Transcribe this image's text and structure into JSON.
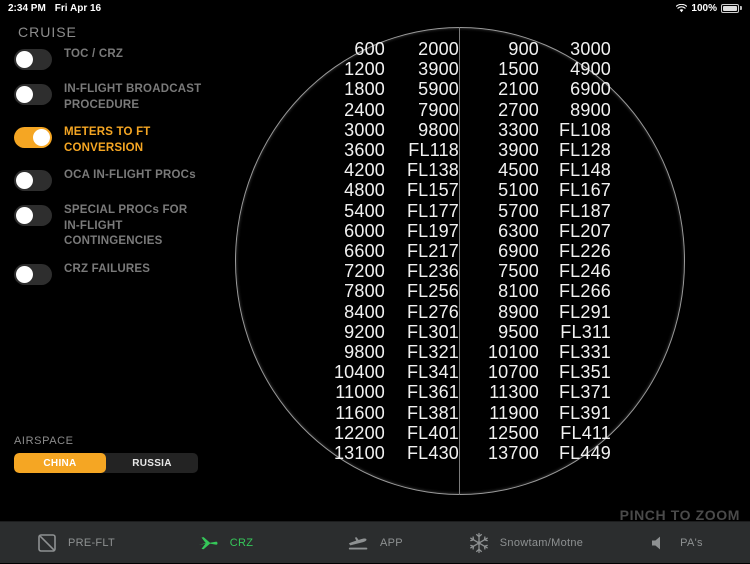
{
  "statusbar": {
    "time": "2:34 PM",
    "date": "Fri Apr 16",
    "wifi_icon": "wifi-icon",
    "battery_percent": "100%",
    "battery_icon": "battery-full-icon"
  },
  "sidebar": {
    "title": "CRUISE",
    "toggles": [
      {
        "label": "TOC / CRZ",
        "on": false
      },
      {
        "label": "IN-FLIGHT BROADCAST PROCEDURE",
        "on": false
      },
      {
        "label": "METERS TO FT CONVERSION",
        "on": true
      },
      {
        "label": "OCA IN-FLIGHT PROCs",
        "on": false
      },
      {
        "label": "SPECIAL PROCs FOR IN-FLIGHT CONTINGENCIES",
        "on": false
      },
      {
        "label": "CRZ FAILURES",
        "on": false
      }
    ],
    "airspace": {
      "label": "AIRSPACE",
      "options": [
        {
          "label": "CHINA",
          "selected": true
        },
        {
          "label": "RUSSIA",
          "selected": false
        }
      ]
    }
  },
  "main": {
    "pinch_hint": "PINCH TO ZOOM",
    "conversion_rows": [
      [
        "600",
        "2000",
        "900",
        "3000"
      ],
      [
        "1200",
        "3900",
        "1500",
        "4900"
      ],
      [
        "1800",
        "5900",
        "2100",
        "6900"
      ],
      [
        "2400",
        "7900",
        "2700",
        "8900"
      ],
      [
        "3000",
        "9800",
        "3300",
        "FL108"
      ],
      [
        "3600",
        "FL118",
        "3900",
        "FL128"
      ],
      [
        "4200",
        "FL138",
        "4500",
        "FL148"
      ],
      [
        "4800",
        "FL157",
        "5100",
        "FL167"
      ],
      [
        "5400",
        "FL177",
        "5700",
        "FL187"
      ],
      [
        "6000",
        "FL197",
        "6300",
        "FL207"
      ],
      [
        "6600",
        "FL217",
        "6900",
        "FL226"
      ],
      [
        "7200",
        "FL236",
        "7500",
        "FL246"
      ],
      [
        "7800",
        "FL256",
        "8100",
        "FL266"
      ],
      [
        "8400",
        "FL276",
        "8900",
        "FL291"
      ],
      [
        "9200",
        "FL301",
        "9500",
        "FL311"
      ],
      [
        "9800",
        "FL321",
        "10100",
        "FL331"
      ],
      [
        "10400",
        "FL341",
        "10700",
        "FL351"
      ],
      [
        "11000",
        "FL361",
        "11300",
        "FL371"
      ],
      [
        "11600",
        "FL381",
        "11900",
        "FL391"
      ],
      [
        "12200",
        "FL401",
        "12500",
        "FL411"
      ],
      [
        "13100",
        "FL430",
        "13700",
        "FL449"
      ]
    ]
  },
  "tabbar": {
    "tabs": [
      {
        "label": "PRE-FLT",
        "icon": "checklist-icon",
        "active": false
      },
      {
        "label": "CRZ",
        "icon": "airplane-icon",
        "active": true
      },
      {
        "label": "APP",
        "icon": "landing-icon",
        "active": false
      },
      {
        "label": "Snowtam/Motne",
        "icon": "snowflake-icon",
        "active": false
      },
      {
        "label": "PA's",
        "icon": "speaker-icon",
        "active": false
      }
    ]
  },
  "colors": {
    "accent": "#F5A623",
    "active_tab": "#35c759",
    "background": "#000000",
    "tabbar_bg": "#2b2d2e"
  }
}
